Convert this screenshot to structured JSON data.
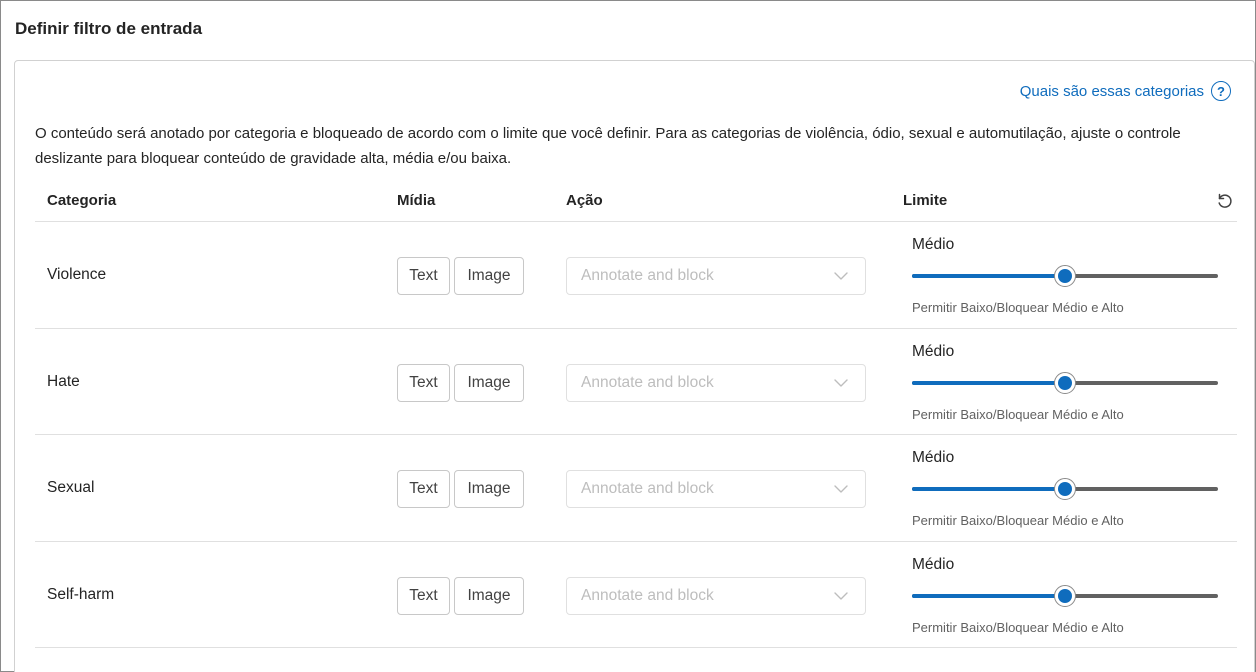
{
  "page": {
    "title": "Definir filtro de entrada"
  },
  "help_link": {
    "label": "Quais são essas categorias",
    "icon": "question-circle-icon"
  },
  "description": "O conteúdo será anotado por categoria e bloqueado de acordo com o limite que você definir. Para as categorias de violência, ódio, sexual e automutilação, ajuste o controle deslizante para bloquear conteúdo de gravidade alta, média e/ou baixa.",
  "table": {
    "headers": {
      "category": "Categoria",
      "media": "Mídia",
      "action": "Ação",
      "limit": "Limite"
    },
    "reset_icon": "reset-icon",
    "rows": [
      {
        "category": "Violence",
        "media": [
          "Text",
          "Image"
        ],
        "action": "Annotate and block",
        "limit_label": "Médio",
        "limit_level": 0.5,
        "limit_description": "Permitir Baixo/Bloquear Médio e Alto"
      },
      {
        "category": "Hate",
        "media": [
          "Text",
          "Image"
        ],
        "action": "Annotate and block",
        "limit_label": "Médio",
        "limit_level": 0.5,
        "limit_description": "Permitir Baixo/Bloquear Médio e Alto"
      },
      {
        "category": "Sexual",
        "media": [
          "Text",
          "Image"
        ],
        "action": "Annotate and block",
        "limit_label": "Médio",
        "limit_level": 0.5,
        "limit_description": "Permitir Baixo/Bloquear Médio e Alto"
      },
      {
        "category": "Self-harm",
        "media": [
          "Text",
          "Image"
        ],
        "action": "Annotate and block",
        "limit_label": "Médio",
        "limit_level": 0.5,
        "limit_description": "Permitir Baixo/Bloquear Médio e Alto"
      }
    ]
  },
  "colors": {
    "accent": "#0f6cbd",
    "track": "#616161",
    "disabled_text": "#bdbdbd",
    "border": "#e0e0e0"
  }
}
